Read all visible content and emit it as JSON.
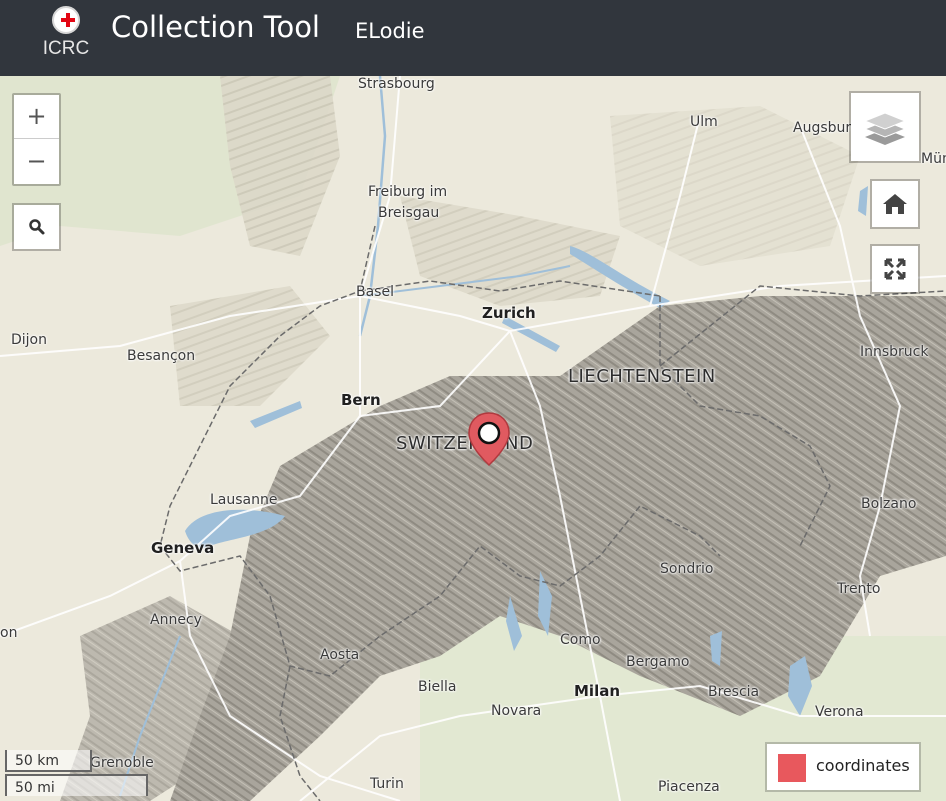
{
  "header": {
    "logo_text": "ICRC",
    "app_title": "Collection Tool",
    "user_name": "ELodie"
  },
  "map": {
    "controls": {
      "zoom_in_label": "+",
      "zoom_out_label": "−",
      "search_icon": "search-icon",
      "layers_icon": "layers-icon",
      "home_icon": "home-icon",
      "fullscreen_icon": "fullscreen-icon"
    },
    "labels": {
      "strasbourg": "Strasbourg",
      "ulm": "Ulm",
      "augsburg": "Augsburg",
      "munich_partial": "Mün",
      "freiburg_1": "Freiburg im",
      "freiburg_2": "Breisgau",
      "basel": "Basel",
      "zurich": "Zurich",
      "dijon": "Dijon",
      "besancon": "Besançon",
      "liechtenstein": "LIECHTENSTEIN",
      "innsbruck": "Innsbruck",
      "bern": "Bern",
      "switzerland": "SWITZERLAND",
      "lausanne": "Lausanne",
      "bolzano": "Bolzano",
      "geneva": "Geneva",
      "sondrio": "Sondrio",
      "trento": "Trento",
      "annecy": "Annecy",
      "lyon_partial": "on",
      "como": "Como",
      "aosta": "Aosta",
      "bergamo": "Bergamo",
      "biella": "Biella",
      "milan": "Milan",
      "brescia": "Brescia",
      "novara": "Novara",
      "verona": "Verona",
      "grenoble": "Grenoble",
      "turin": "Turin",
      "piacenza": "Piacenza"
    },
    "scale": {
      "metric": "50 km",
      "imperial": "50 mi"
    },
    "legend": {
      "label": "coordinates",
      "color": "#e8585d"
    },
    "marker": {
      "color": "#e05a60",
      "icon": "map-pin-icon"
    },
    "colors": {
      "header_bg": "#31363d",
      "lowland": "#ece9dc",
      "mountain": "#a7a39a",
      "water": "#9fbfd9"
    }
  }
}
